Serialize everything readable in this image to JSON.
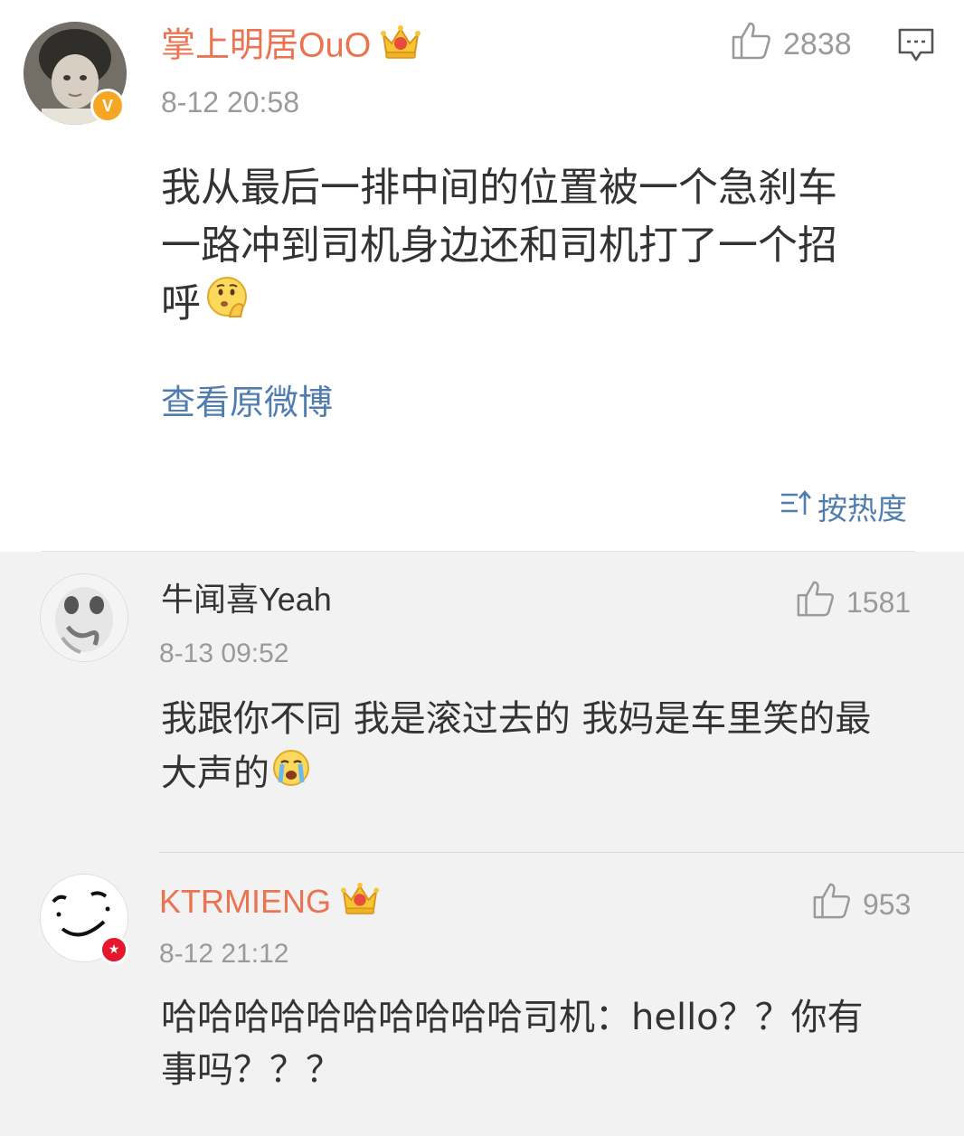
{
  "main_comment": {
    "username": "掌上明居OuO",
    "verified_badge": "V",
    "timestamp": "8-12 20:58",
    "likes": "2838",
    "text_lines": [
      "我从最后一排中间的位置被一个急刹车",
      "一路冲到司机身边还和司机打了一个招",
      "呼"
    ],
    "emoji": "thinking-face",
    "view_original_link": "查看原微博",
    "sort_label": "按热度"
  },
  "replies": [
    {
      "username": "牛闻喜Yeah",
      "timestamp": "8-13 09:52",
      "likes": "1581",
      "text_lines": [
        "我跟你不同 我是滚过去的 我妈是车里笑的最",
        "大声的"
      ],
      "emoji": "crying-face"
    },
    {
      "username": "KTRMIENG",
      "timestamp": "8-12 21:12",
      "likes": "953",
      "text_lines": [
        "哈哈哈哈哈哈哈哈哈哈司机：hello？？你有",
        "事吗？？？"
      ]
    }
  ],
  "colors": {
    "vip_name": "#eb7350",
    "link_blue": "#507daf",
    "muted_gray": "#9a9a9a",
    "reply_bg": "#f2f2f2",
    "badge_gold": "#f5a623",
    "badge_red": "#e6162d"
  }
}
